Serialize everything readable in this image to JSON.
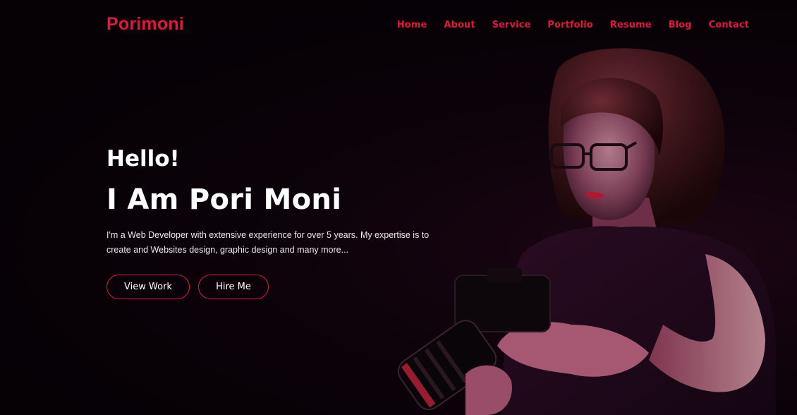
{
  "header": {
    "logo": "Porimoni",
    "nav": [
      {
        "label": "Home"
      },
      {
        "label": "About"
      },
      {
        "label": "Service"
      },
      {
        "label": "Portfolio"
      },
      {
        "label": "Resume"
      },
      {
        "label": "Blog"
      },
      {
        "label": "Contact"
      }
    ]
  },
  "hero": {
    "greeting": "Hello!",
    "name": "I Am Pori Moni",
    "description": "I'm a Web Developer with extensive experience for over 5 years. My expertise is to create and Websites design, graphic design and many more...",
    "buttons": {
      "view_work": "View Work",
      "hire_me": "Hire Me"
    }
  },
  "colors": {
    "accent": "#e3173d",
    "background": "#040104",
    "text": "#ffffff"
  }
}
